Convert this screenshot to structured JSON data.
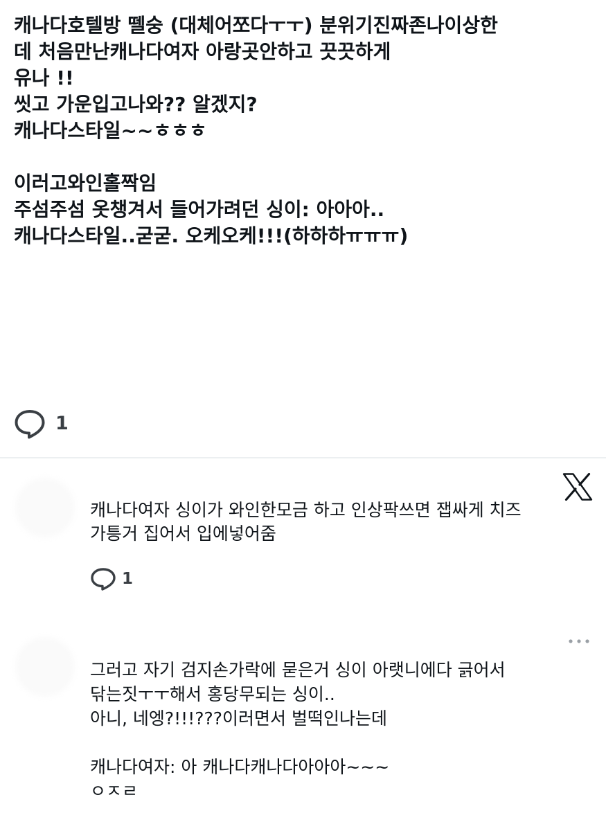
{
  "main_tweet": {
    "lines": [
      "캐나다호텔방 뗄숭 (대체어쪼다ㅜㅜ)  분위기진짜존나이상한",
      "데 처음만난캐나다여자 아랑곳안하고 끗끗하게",
      "유나 !!",
      "씻고 가운입고나와?? 알겠지?",
      "캐나다스타일~~ㅎㅎㅎ",
      "",
      "이러고와인홀짝임",
      "주섬주섬 옷챙겨서 들어가려던 싱이: 아아아..",
      "캐나다스타일..굳굳. 오케오케!!!(하하하ㅠㅠㅠ)"
    ],
    "reply_count": "1"
  },
  "replies": [
    {
      "lines": [
        "캐나다여자 싱이가 와인한모금 하고 인상팍쓰면 잽싸게 치즈",
        "가틍거  집어서 입에넣어줌"
      ],
      "reply_count": "1"
    },
    {
      "lines": [
        "그러고 자기 검지손가락에 묻은거 싱이 아랫니에다 긁어서",
        "닦는짓ㅜㅜ해서  홍당무되는 싱이..",
        "아니,    네엥?!!!???이러면서   벌떡인나는데",
        "",
        "캐나다여자:   아 캐나다캐나다아아아~~~",
        "ㅇㅈㄹ"
      ]
    }
  ],
  "icons": {
    "reply": "speech-bubble-icon",
    "logo": "x-logo-icon",
    "more": "more-dots-icon"
  },
  "colors": {
    "text": "#0f1419",
    "icon": "#3a3f44",
    "divider": "#eceff1"
  }
}
